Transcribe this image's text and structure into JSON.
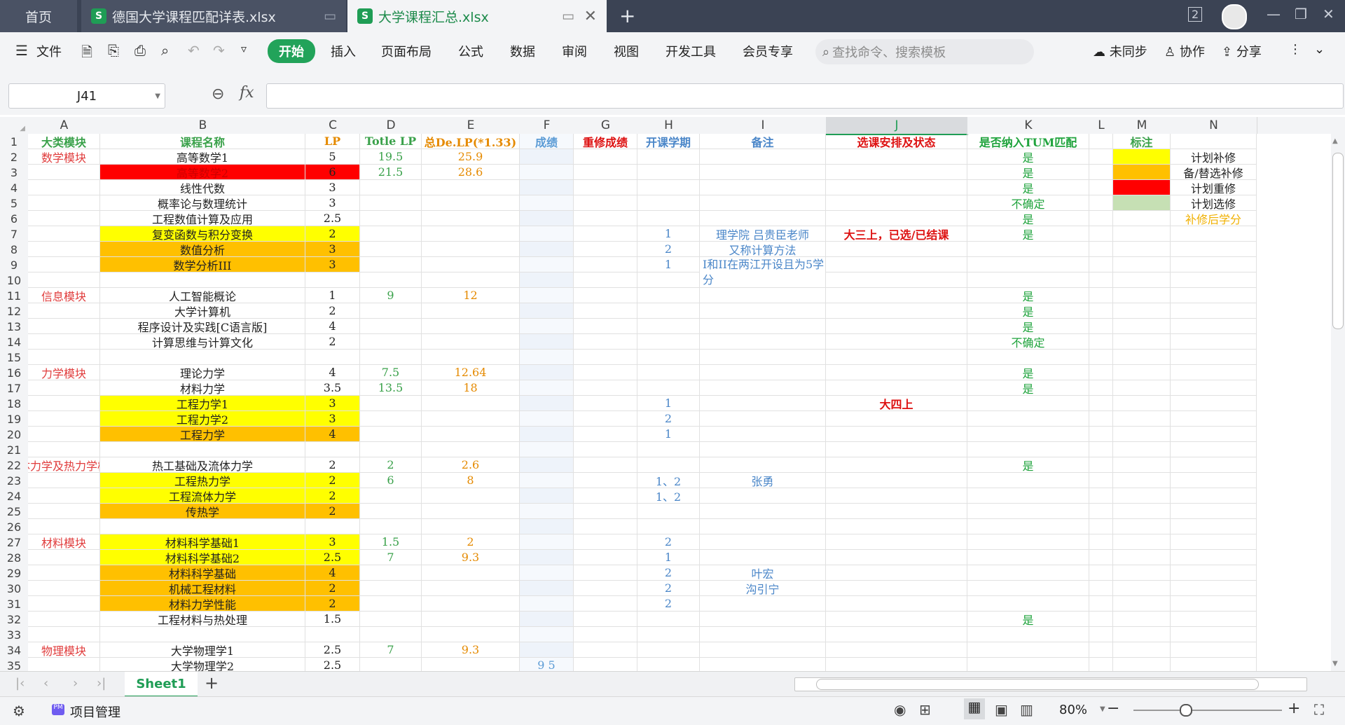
{
  "tabs": {
    "home": "首页",
    "file1": "德国大学课程匹配详表.xlsx",
    "file2": "大学课程汇总.xlsx"
  },
  "menu": {
    "file": "文件",
    "items": [
      "开始",
      "插入",
      "页面布局",
      "公式",
      "数据",
      "审阅",
      "视图",
      "开发工具",
      "会员专享"
    ],
    "search_placeholder": "查找命令、搜索模板",
    "unsync": "未同步",
    "collab": "协作",
    "share": "分享"
  },
  "formula": {
    "cell_ref": "J41",
    "fx": "fx",
    "value": ""
  },
  "columns": [
    "A",
    "B",
    "C",
    "D",
    "E",
    "F",
    "G",
    "H",
    "I",
    "J",
    "K",
    "L",
    "M",
    "N"
  ],
  "rows": [
    [
      "大类模块",
      "课程名称",
      "LP",
      "Totle LP",
      "总De.LP(*1.33)",
      "成绩",
      "重修成绩",
      "开课学期",
      "备注",
      "选课安排及状态",
      "是否纳入TUM匹配",
      "",
      "标注",
      ""
    ],
    [
      "数学模块",
      "高等数学1",
      "5",
      "19.5",
      "25.9",
      "",
      "",
      "",
      "",
      "",
      "是",
      "",
      "",
      "计划补修"
    ],
    [
      "",
      "高等数学2",
      "6",
      "21.5",
      "28.6",
      "",
      "",
      "",
      "",
      "",
      "是",
      "",
      "",
      "备/替选补修"
    ],
    [
      "",
      "线性代数",
      "3",
      "",
      "",
      "",
      "",
      "",
      "",
      "",
      "是",
      "",
      "",
      "计划重修"
    ],
    [
      "",
      "概率论与数理统计",
      "3",
      "",
      "",
      "",
      "",
      "",
      "",
      "",
      "不确定",
      "",
      "",
      "计划选修"
    ],
    [
      "",
      "工程数值计算及应用",
      "2.5",
      "",
      "",
      "",
      "",
      "",
      "",
      "",
      "是",
      "",
      "",
      "补修后学分"
    ],
    [
      "",
      "复变函数与积分变换",
      "2",
      "",
      "",
      "",
      "",
      "1",
      "理学院 吕贵臣老师",
      "大三上，已选/已结课",
      "是",
      "",
      "",
      ""
    ],
    [
      "",
      "数值分析",
      "3",
      "",
      "",
      "",
      "",
      "2",
      "又称计算方法",
      "",
      "",
      "",
      "",
      ""
    ],
    [
      "",
      "数学分析III",
      "3",
      "",
      "",
      "",
      "",
      "1",
      "I和II在两江开设且为5学分",
      "",
      "",
      "",
      "",
      ""
    ],
    [
      "",
      "",
      "",
      "",
      "",
      "",
      "",
      "",
      "",
      "",
      "",
      "",
      "",
      ""
    ],
    [
      "信息模块",
      "人工智能概论",
      "1",
      "9",
      "12",
      "",
      "",
      "",
      "",
      "",
      "是",
      "",
      "",
      ""
    ],
    [
      "",
      "大学计算机",
      "2",
      "",
      "",
      "",
      "",
      "",
      "",
      "",
      "是",
      "",
      "",
      ""
    ],
    [
      "",
      "程序设计及实践[C语言版]",
      "4",
      "",
      "",
      "",
      "",
      "",
      "",
      "",
      "是",
      "",
      "",
      ""
    ],
    [
      "",
      "计算思维与计算文化",
      "2",
      "",
      "",
      "",
      "",
      "",
      "",
      "",
      "不确定",
      "",
      "",
      ""
    ],
    [
      "",
      "",
      "",
      "",
      "",
      "",
      "",
      "",
      "",
      "",
      "",
      "",
      "",
      ""
    ],
    [
      "力学模块",
      "理论力学",
      "4",
      "7.5",
      "12.64",
      "",
      "",
      "",
      "",
      "",
      "是",
      "",
      "",
      ""
    ],
    [
      "",
      "材料力学",
      "3.5",
      "13.5",
      "18",
      "",
      "",
      "",
      "",
      "",
      "是",
      "",
      "",
      ""
    ],
    [
      "",
      "工程力学1",
      "3",
      "",
      "",
      "",
      "",
      "1",
      "",
      "大四上",
      "",
      "",
      "",
      ""
    ],
    [
      "",
      "工程力学2",
      "3",
      "",
      "",
      "",
      "",
      "2",
      "",
      "",
      "",
      "",
      "",
      ""
    ],
    [
      "",
      "工程力学",
      "4",
      "",
      "",
      "",
      "",
      "1",
      "",
      "",
      "",
      "",
      "",
      ""
    ],
    [
      "",
      "",
      "",
      "",
      "",
      "",
      "",
      "",
      "",
      "",
      "",
      "",
      "",
      ""
    ],
    [
      "流体力学及热力学模块",
      "热工基础及流体力学",
      "2",
      "2",
      "2.6",
      "",
      "",
      "",
      "",
      "",
      "是",
      "",
      "",
      ""
    ],
    [
      "",
      "工程热力学",
      "2",
      "6",
      "8",
      "",
      "",
      "1、2",
      "张勇",
      "",
      "",
      "",
      "",
      ""
    ],
    [
      "",
      "工程流体力学",
      "2",
      "",
      "",
      "",
      "",
      "1、2",
      "",
      "",
      "",
      "",
      "",
      ""
    ],
    [
      "",
      "传热学",
      "2",
      "",
      "",
      "",
      "",
      "",
      "",
      "",
      "",
      "",
      "",
      ""
    ],
    [
      "",
      "",
      "",
      "",
      "",
      "",
      "",
      "",
      "",
      "",
      "",
      "",
      "",
      ""
    ],
    [
      "材料模块",
      "材料科学基础1",
      "3",
      "1.5",
      "2",
      "",
      "",
      "2",
      "",
      "",
      "",
      "",
      "",
      ""
    ],
    [
      "",
      "材料科学基础2",
      "2.5",
      "7",
      "9.3",
      "",
      "",
      "1",
      "",
      "",
      "",
      "",
      "",
      ""
    ],
    [
      "",
      "材料科学基础",
      "4",
      "",
      "",
      "",
      "",
      "2",
      "叶宏",
      "",
      "",
      "",
      "",
      ""
    ],
    [
      "",
      "机械工程材料",
      "2",
      "",
      "",
      "",
      "",
      "2",
      "沟引宁",
      "",
      "",
      "",
      "",
      ""
    ],
    [
      "",
      "材料力学性能",
      "2",
      "",
      "",
      "",
      "",
      "2",
      "",
      "",
      "",
      "",
      "",
      ""
    ],
    [
      "",
      "工程材料与热处理",
      "1.5",
      "",
      "",
      "",
      "",
      "",
      "",
      "",
      "是",
      "",
      "",
      ""
    ],
    [
      "",
      "",
      "",
      "",
      "",
      "",
      "",
      "",
      "",
      "",
      "",
      "",
      "",
      ""
    ],
    [
      "物理模块",
      "大学物理学1",
      "2.5",
      "7",
      "9.3",
      "",
      "",
      "",
      "",
      "",
      "",
      "",
      "",
      ""
    ],
    [
      "",
      "大学物理学2",
      "2.5",
      "",
      "",
      "9 5",
      "",
      "",
      "",
      "",
      "",
      "",
      "",
      ""
    ]
  ],
  "colors": {
    "yellow": "#ffff00",
    "orange": "#ffc000",
    "red": "#ff0000",
    "green_light": "#c6e0b4",
    "brand_green": "#22a35a"
  },
  "sheet": {
    "name": "Sheet1"
  },
  "status": {
    "project": "项目管理",
    "zoom": "80%"
  }
}
